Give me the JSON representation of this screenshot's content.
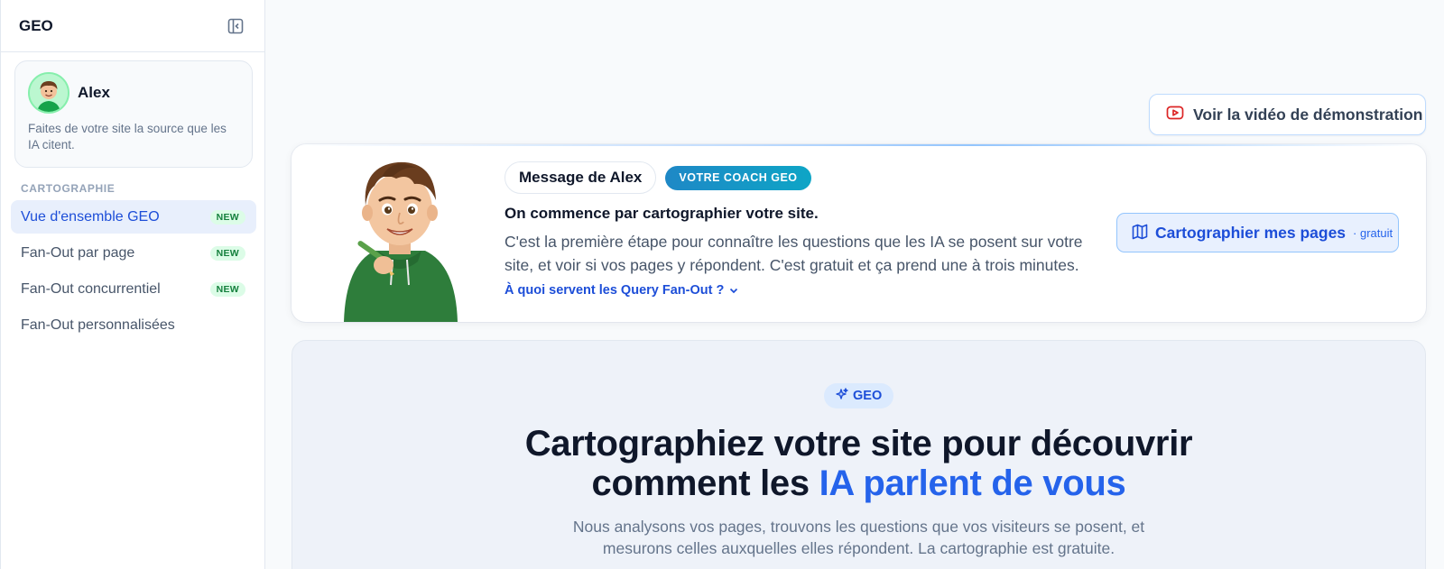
{
  "sidebar": {
    "title": "GEO",
    "profile": {
      "name": "Alex",
      "description": "Faites de votre site la source que les IA citent."
    },
    "section_label": "CARTOGRAPHIE",
    "items": [
      {
        "label": "Vue d'ensemble GEO",
        "badge": "NEW",
        "active": true
      },
      {
        "label": "Fan-Out par page",
        "badge": "NEW",
        "active": false
      },
      {
        "label": "Fan-Out concurrentiel",
        "badge": "NEW",
        "active": false
      },
      {
        "label": "Fan-Out personnalisées",
        "badge": "",
        "active": false
      }
    ]
  },
  "header": {
    "demo_button": "Voir la vidéo de démonstration"
  },
  "coach": {
    "message_pill": "Message de Alex",
    "tag": "VOTRE COACH GEO",
    "heading": "On commence par cartographier votre site.",
    "text_line1": "C'est la première étape pour connaître les questions que les IA se posent sur votre",
    "text_line2": "site, et voir si vos pages y répondent. C'est gratuit et ça prend une à trois minutes.",
    "faq_link": "À quoi servent les Query Fan-Out ?",
    "cta_label": "Cartographier mes pages",
    "cta_sub": "· gratuit"
  },
  "hero": {
    "badge": "GEO",
    "title_line1": "Cartographiez votre site pour découvrir",
    "title_line2_plain": "comment les ",
    "title_line2_accent": "IA parlent de vous",
    "subtitle_line1": "Nous analysons vos pages, trouvons les questions que vos visiteurs se posent, et",
    "subtitle_line2": "mesurons celles auxquelles elles répondent. La cartographie est gratuite."
  },
  "colors": {
    "accent": "#2563eb",
    "accent_dark": "#1d4ed8",
    "badge_new_bg": "#dcfce7",
    "badge_new_text": "#15803d",
    "coach_tag_bg": "#1e88c6",
    "youtube_red": "#dc2626"
  },
  "icons": {
    "collapse": "sidebar-collapse-icon",
    "demo": "youtube-play-icon",
    "cta": "map-icon",
    "faq": "chevron-down-icon",
    "hero_badge": "sparkles-icon"
  }
}
